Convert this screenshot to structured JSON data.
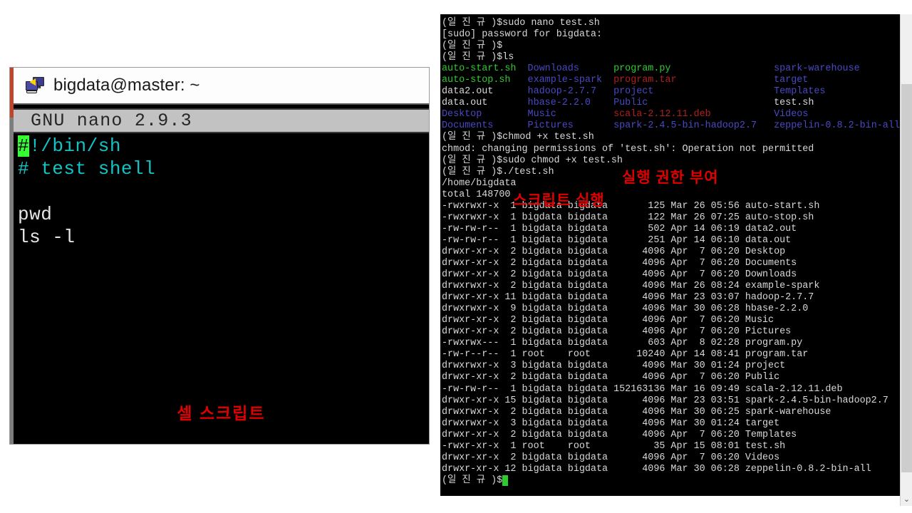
{
  "nano_window": {
    "titlebar": {
      "icon": "remote-desktop-icon",
      "title": "bigdata@master: ~"
    },
    "statusbar": {
      "text": "GNU nano 2.9.3"
    },
    "editor": {
      "lines": [
        {
          "cursor_char": "#",
          "rest": "!/bin/sh",
          "color": "cyan"
        },
        {
          "cursor_char": "",
          "rest": "# test shell",
          "color": "cyan"
        },
        {
          "cursor_char": "",
          "rest": "",
          "color": "white"
        },
        {
          "cursor_char": "",
          "rest": "pwd",
          "color": "white"
        },
        {
          "cursor_char": "",
          "rest": "ls -l",
          "color": "white"
        }
      ]
    },
    "annotation": "셀 스크립트"
  },
  "terminal": {
    "prompt": "(일 진 규 )$",
    "annotations": {
      "permission": "실행 권한 부여",
      "run_script": "스크립트 실행"
    },
    "lines": [
      {
        "segs": [
          {
            "t": "(일 진 규 )$sudo nano test.sh",
            "c": "white"
          }
        ]
      },
      {
        "segs": [
          {
            "t": "[sudo] password for bigdata:",
            "c": "white"
          }
        ]
      },
      {
        "segs": [
          {
            "t": "(일 진 규 )$",
            "c": "white"
          }
        ]
      },
      {
        "segs": [
          {
            "t": "(일 진 규 )$ls",
            "c": "white"
          }
        ]
      },
      {
        "segs": [
          {
            "t": "auto-start.sh",
            "c": "green"
          },
          {
            "t": "  ",
            "c": "white"
          },
          {
            "t": "Downloads",
            "c": "blue"
          },
          {
            "t": "      ",
            "c": "white"
          },
          {
            "t": "program.py",
            "c": "green"
          },
          {
            "t": "                  ",
            "c": "white"
          },
          {
            "t": "spark-warehouse",
            "c": "blue"
          }
        ]
      },
      {
        "segs": [
          {
            "t": "auto-stop.sh",
            "c": "green"
          },
          {
            "t": "   ",
            "c": "white"
          },
          {
            "t": "example-spark",
            "c": "blue"
          },
          {
            "t": "  ",
            "c": "white"
          },
          {
            "t": "program.tar",
            "c": "red"
          },
          {
            "t": "                 ",
            "c": "white"
          },
          {
            "t": "target",
            "c": "blue"
          }
        ]
      },
      {
        "segs": [
          {
            "t": "data2.out",
            "c": "white"
          },
          {
            "t": "      ",
            "c": "white"
          },
          {
            "t": "hadoop-2.7.7",
            "c": "blue"
          },
          {
            "t": "   ",
            "c": "white"
          },
          {
            "t": "project",
            "c": "blue"
          },
          {
            "t": "                     ",
            "c": "white"
          },
          {
            "t": "Templates",
            "c": "blue"
          }
        ]
      },
      {
        "segs": [
          {
            "t": "data.out",
            "c": "white"
          },
          {
            "t": "       ",
            "c": "white"
          },
          {
            "t": "hbase-2.2.0",
            "c": "blue"
          },
          {
            "t": "    ",
            "c": "white"
          },
          {
            "t": "Public",
            "c": "blue"
          },
          {
            "t": "                      ",
            "c": "white"
          },
          {
            "t": "test.sh",
            "c": "white"
          }
        ]
      },
      {
        "segs": [
          {
            "t": "Desktop",
            "c": "blue"
          },
          {
            "t": "        ",
            "c": "white"
          },
          {
            "t": "Music",
            "c": "blue"
          },
          {
            "t": "          ",
            "c": "white"
          },
          {
            "t": "scala-2.12.11.deb",
            "c": "red"
          },
          {
            "t": "           ",
            "c": "white"
          },
          {
            "t": "Videos",
            "c": "blue"
          }
        ]
      },
      {
        "segs": [
          {
            "t": "Documents",
            "c": "blue"
          },
          {
            "t": "      ",
            "c": "white"
          },
          {
            "t": "Pictures",
            "c": "blue"
          },
          {
            "t": "       ",
            "c": "white"
          },
          {
            "t": "spark-2.4.5-bin-hadoop2.7",
            "c": "blue"
          },
          {
            "t": "   ",
            "c": "white"
          },
          {
            "t": "zeppelin-0.8.2-bin-all",
            "c": "blue"
          }
        ]
      },
      {
        "segs": [
          {
            "t": "(일 진 규 )$chmod +x test.sh",
            "c": "white"
          }
        ]
      },
      {
        "segs": [
          {
            "t": "chmod: changing permissions of 'test.sh': Operation not permitted",
            "c": "white"
          }
        ]
      },
      {
        "segs": [
          {
            "t": "(일 진 규 )$sudo chmod +x test.sh",
            "c": "white"
          }
        ]
      },
      {
        "segs": [
          {
            "t": "(일 진 규 )$./test.sh",
            "c": "white"
          }
        ]
      },
      {
        "segs": [
          {
            "t": "/home/bigdata",
            "c": "white"
          }
        ]
      },
      {
        "segs": [
          {
            "t": "total 148700",
            "c": "white"
          }
        ]
      },
      {
        "segs": [
          {
            "t": "-rwxrwxr-x  1 bigdata bigdata       125 Mar 26 05:56 auto-start.sh",
            "c": "white"
          }
        ]
      },
      {
        "segs": [
          {
            "t": "-rwxrwxr-x  1 bigdata bigdata       122 Mar 26 07:25 auto-stop.sh",
            "c": "white"
          }
        ]
      },
      {
        "segs": [
          {
            "t": "-rw-rw-r--  1 bigdata bigdata       502 Apr 14 06:19 data2.out",
            "c": "white"
          }
        ]
      },
      {
        "segs": [
          {
            "t": "-rw-rw-r--  1 bigdata bigdata       251 Apr 14 06:10 data.out",
            "c": "white"
          }
        ]
      },
      {
        "segs": [
          {
            "t": "drwxr-xr-x  2 bigdata bigdata      4096 Apr  7 06:20 Desktop",
            "c": "white"
          }
        ]
      },
      {
        "segs": [
          {
            "t": "drwxr-xr-x  2 bigdata bigdata      4096 Apr  7 06:20 Documents",
            "c": "white"
          }
        ]
      },
      {
        "segs": [
          {
            "t": "drwxr-xr-x  2 bigdata bigdata      4096 Apr  7 06:20 Downloads",
            "c": "white"
          }
        ]
      },
      {
        "segs": [
          {
            "t": "drwxrwxr-x  2 bigdata bigdata      4096 Mar 26 08:24 example-spark",
            "c": "white"
          }
        ]
      },
      {
        "segs": [
          {
            "t": "drwxr-xr-x 11 bigdata bigdata      4096 Mar 23 03:07 hadoop-2.7.7",
            "c": "white"
          }
        ]
      },
      {
        "segs": [
          {
            "t": "drwxrwxr-x  9 bigdata bigdata      4096 Mar 30 06:28 hbase-2.2.0",
            "c": "white"
          }
        ]
      },
      {
        "segs": [
          {
            "t": "drwxr-xr-x  2 bigdata bigdata      4096 Apr  7 06:20 Music",
            "c": "white"
          }
        ]
      },
      {
        "segs": [
          {
            "t": "drwxr-xr-x  2 bigdata bigdata      4096 Apr  7 06:20 Pictures",
            "c": "white"
          }
        ]
      },
      {
        "segs": [
          {
            "t": "-rwxrwx---  1 bigdata bigdata       603 Apr  8 02:28 program.py",
            "c": "white"
          }
        ]
      },
      {
        "segs": [
          {
            "t": "-rw-r--r--  1 root    root        10240 Apr 14 08:41 program.tar",
            "c": "white"
          }
        ]
      },
      {
        "segs": [
          {
            "t": "drwxrwxr-x  3 bigdata bigdata      4096 Mar 30 01:24 project",
            "c": "white"
          }
        ]
      },
      {
        "segs": [
          {
            "t": "drwxr-xr-x  2 bigdata bigdata      4096 Apr  7 06:20 Public",
            "c": "white"
          }
        ]
      },
      {
        "segs": [
          {
            "t": "-rw-rw-r--  1 bigdata bigdata 152163136 Mar 16 09:49 scala-2.12.11.deb",
            "c": "white"
          }
        ]
      },
      {
        "segs": [
          {
            "t": "drwxr-xr-x 15 bigdata bigdata      4096 Mar 23 03:51 spark-2.4.5-bin-hadoop2.7",
            "c": "white"
          }
        ]
      },
      {
        "segs": [
          {
            "t": "drwxrwxr-x  2 bigdata bigdata      4096 Mar 30 06:25 spark-warehouse",
            "c": "white"
          }
        ]
      },
      {
        "segs": [
          {
            "t": "drwxrwxr-x  3 bigdata bigdata      4096 Mar 30 01:24 target",
            "c": "white"
          }
        ]
      },
      {
        "segs": [
          {
            "t": "drwxr-xr-x  2 bigdata bigdata      4096 Apr  7 06:20 Templates",
            "c": "white"
          }
        ]
      },
      {
        "segs": [
          {
            "t": "-rwxr-xr-x  1 root    root           35 Apr 15 08:01 test.sh",
            "c": "white"
          }
        ]
      },
      {
        "segs": [
          {
            "t": "drwxr-xr-x  2 bigdata bigdata      4096 Apr  7 06:20 Videos",
            "c": "white"
          }
        ]
      },
      {
        "segs": [
          {
            "t": "drwxr-xr-x 12 bigdata bigdata      4096 Mar 30 06:28 zeppelin-0.8.2-bin-all",
            "c": "white"
          }
        ]
      },
      {
        "segs": [
          {
            "t": "(일 진 규 )$",
            "c": "white"
          },
          {
            "t": " ",
            "c": "cursor"
          }
        ]
      }
    ]
  },
  "scrollbar": {
    "down_arrow_glyph": "⌄"
  },
  "colors": {
    "terminal_bg": "#000000",
    "text_white": "#d9d9d9",
    "text_green": "#2ecb2e",
    "text_blue": "#4a49c4",
    "text_red": "#b02020",
    "cursor_green": "#2ecb2e",
    "annotation_red": "#e00000",
    "nano_status_bg": "#c2c2c2",
    "nano_cyan": "#12c4c4"
  }
}
